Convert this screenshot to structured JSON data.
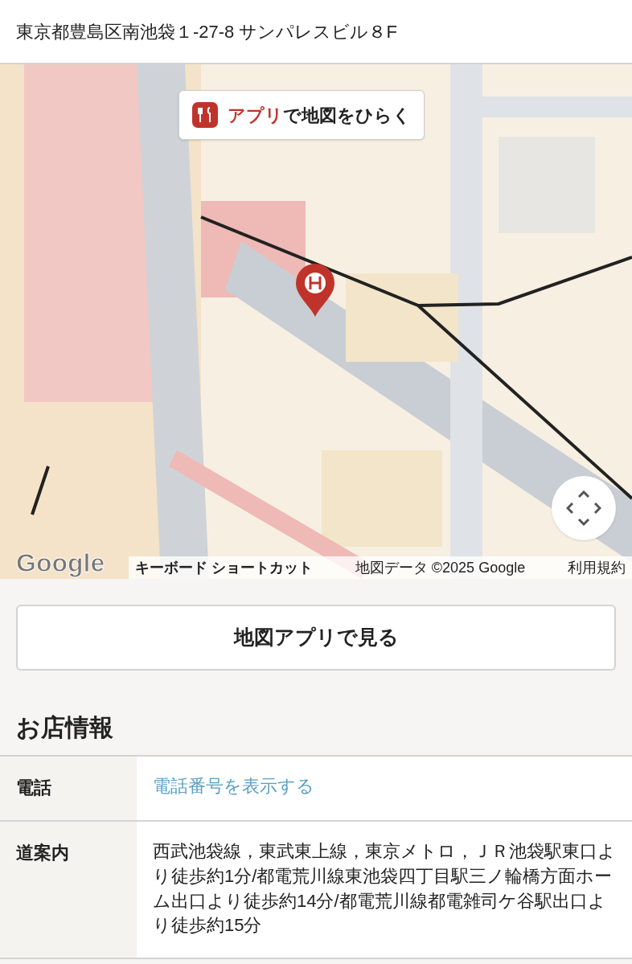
{
  "address": "東京都豊島区南池袋１-27-8 サンパレスビル８F",
  "map": {
    "open_app_button": {
      "accent": "アプリ",
      "text": "で地図をひらく"
    },
    "logo": "Google",
    "attribution": [
      {
        "kind": "bold",
        "text": "キーボード ショートカット"
      },
      {
        "kind": "plain",
        "text": "地図データ ©2025 Google"
      },
      {
        "kind": "plain",
        "text": "利用規約"
      }
    ]
  },
  "map_app_button": "地図アプリで見る",
  "section_title": "お店情報",
  "info_rows": [
    {
      "label": "電話",
      "kind": "link",
      "value": "電話番号を表示する"
    },
    {
      "label": "道案内",
      "kind": "text",
      "value": "西武池袋線，東武東上線，東京メトロ，ＪＲ池袋駅東口より徒歩約1分/都電荒川線東池袋四丁目駅三ノ輪橋方面ホーム出口より徒歩約14分/都電荒川線都電雑司ケ谷駅出口より徒歩約15分"
    }
  ]
}
